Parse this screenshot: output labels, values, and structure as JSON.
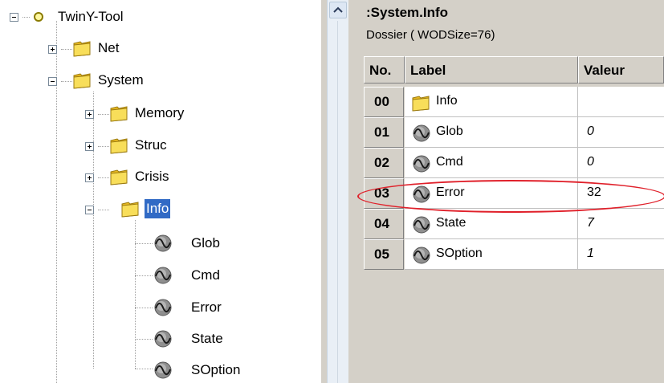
{
  "tree": {
    "root": "TwinY-Tool",
    "nodes": [
      {
        "label": "Net",
        "state": "collapsed"
      },
      {
        "label": "System",
        "state": "expanded"
      },
      {
        "label": "Memory",
        "state": "collapsed"
      },
      {
        "label": "Struc",
        "state": "collapsed"
      },
      {
        "label": "Crisis",
        "state": "collapsed"
      },
      {
        "label": "Info",
        "state": "expanded",
        "selected": true
      },
      {
        "label": "Glob"
      },
      {
        "label": "Cmd"
      },
      {
        "label": "Error"
      },
      {
        "label": "State"
      },
      {
        "label": "SOption"
      }
    ]
  },
  "panel": {
    "title": ":System.Info",
    "subtitle": "Dossier ( WODSize=76)",
    "columns": {
      "no": "No.",
      "label": "Label",
      "value": "Valeur"
    },
    "rows": [
      {
        "no": "00",
        "label": "Info",
        "value": "",
        "icon": "folder-icon"
      },
      {
        "no": "01",
        "label": "Glob",
        "value": "0",
        "icon": "signal-icon"
      },
      {
        "no": "02",
        "label": "Cmd",
        "value": "0",
        "icon": "signal-icon"
      },
      {
        "no": "03",
        "label": "Error",
        "value": "32",
        "icon": "signal-icon"
      },
      {
        "no": "04",
        "label": "State",
        "value": "7",
        "icon": "signal-icon"
      },
      {
        "no": "05",
        "label": "SOption",
        "value": "1",
        "icon": "signal-icon"
      }
    ]
  },
  "colors": {
    "selection": "#316ac5",
    "highlight": "#e0202a",
    "folder": "#f2d34a"
  }
}
